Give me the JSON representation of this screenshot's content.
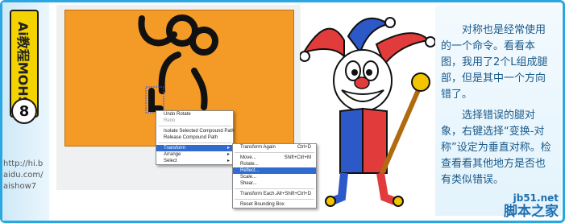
{
  "sidebar": {
    "brand_text": "Ai教程MOHS",
    "step_number": "8",
    "url_lines": [
      "http://hi.b",
      "aidu.com/",
      "aishow7"
    ]
  },
  "colors": {
    "canvas": "#f39a27",
    "highlight": "#2f6bd0",
    "frame": "#2aa7e0"
  },
  "context_menu": {
    "items": [
      {
        "label": "Undo Rotate",
        "disabled": false
      },
      {
        "label": "Redo",
        "disabled": true
      },
      {
        "sep": true
      },
      {
        "label": "Isolate Selected Compound Path",
        "disabled": false
      },
      {
        "label": "Release Compound Path",
        "disabled": false
      },
      {
        "sep": true
      },
      {
        "label": "Transform",
        "submenu": true,
        "highlighted": true
      },
      {
        "label": "Arrange",
        "submenu": true
      },
      {
        "label": "Select",
        "submenu": true
      }
    ]
  },
  "transform_submenu": {
    "items": [
      {
        "label": "Transform Again",
        "shortcut": "Ctrl+D"
      },
      {
        "sep": true
      },
      {
        "label": "Move...",
        "shortcut": "Shift+Ctrl+M"
      },
      {
        "label": "Rotate...",
        "shortcut": ""
      },
      {
        "label": "Reflect...",
        "shortcut": "",
        "highlighted": true
      },
      {
        "label": "Scale...",
        "shortcut": ""
      },
      {
        "label": "Shear...",
        "shortcut": ""
      },
      {
        "sep": true
      },
      {
        "label": "Transform Each...",
        "shortcut": "Alt+Shift+Ctrl+D"
      },
      {
        "sep": true
      },
      {
        "label": "Reset Bounding Box",
        "shortcut": ""
      }
    ]
  },
  "text": {
    "para1": "对称也是经常使用的一个命令。看看本图，我用了2个L组成腿部，但是其中一个方向错了。",
    "para2": "选择错误的腿对象，右键选择“变换-对称”设定为垂直对称。检查看看其他地方是否也有类似错误。"
  },
  "watermark": {
    "site": "jb51.net",
    "name": "脚本之家"
  }
}
